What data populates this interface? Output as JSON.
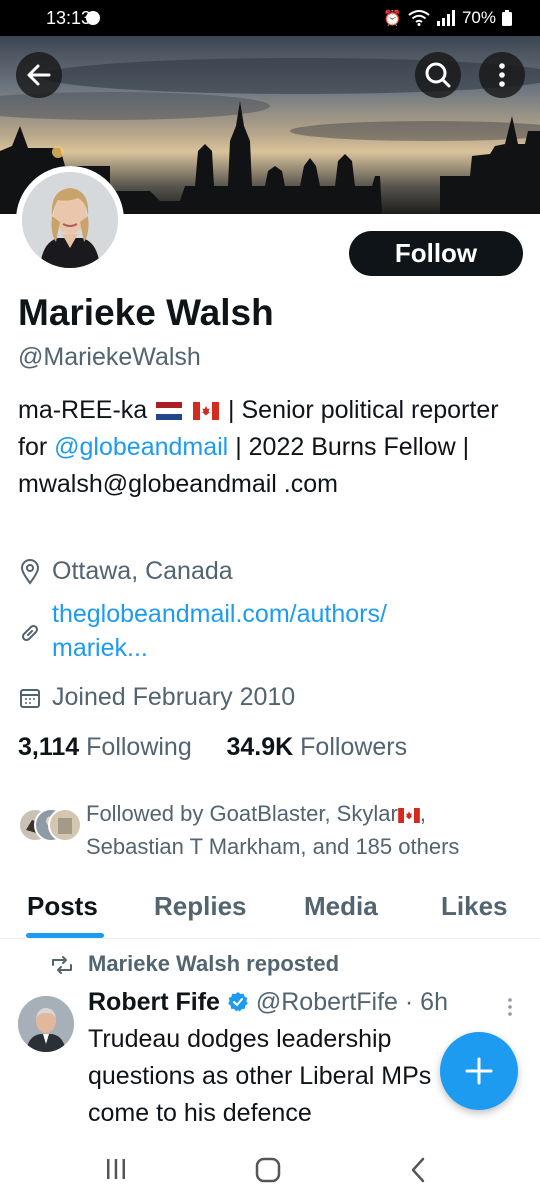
{
  "status_bar": {
    "time": "13:13",
    "battery": "70%"
  },
  "header": {
    "back_icon": "arrow-left-icon",
    "search_icon": "search-icon",
    "more_icon": "more-vertical-icon"
  },
  "profile": {
    "follow_label": "Follow",
    "name": "Marieke Walsh",
    "handle": "@MariekeWalsh",
    "bio_part1": "ma-REE-ka",
    "bio_part2": "| Senior political reporter for",
    "bio_mention": "@globeandmail",
    "bio_part3": "| 2022 Burns Fellow | mwalsh@globeandmail .com",
    "location": "Ottawa, Canada",
    "website_line1": "theglobeandmail.com/authors/",
    "website_line2": "mariek...",
    "joined": "Joined February 2010",
    "following_count": "3,114",
    "following_label": "Following",
    "followers_count": "34.9K",
    "followers_label": "Followers",
    "followed_by": "Followed by GoatBlaster, Skylar",
    "followed_by_rest": ", Sebastian T Markham, and 185 others"
  },
  "tabs": [
    {
      "label": "Posts",
      "active": true
    },
    {
      "label": "Replies",
      "active": false
    },
    {
      "label": "Media",
      "active": false
    },
    {
      "label": "Likes",
      "active": false
    }
  ],
  "post": {
    "repost_label": "Marieke Walsh reposted",
    "author": "Robert Fife",
    "author_handle": "@RobertFife",
    "time": "· 6h",
    "text": "Trudeau dodges leadership questions as other Liberal MPs come to his defence"
  },
  "colors": {
    "accent": "#1d9bf0",
    "text_primary": "#0f1419",
    "text_secondary": "#536471"
  }
}
